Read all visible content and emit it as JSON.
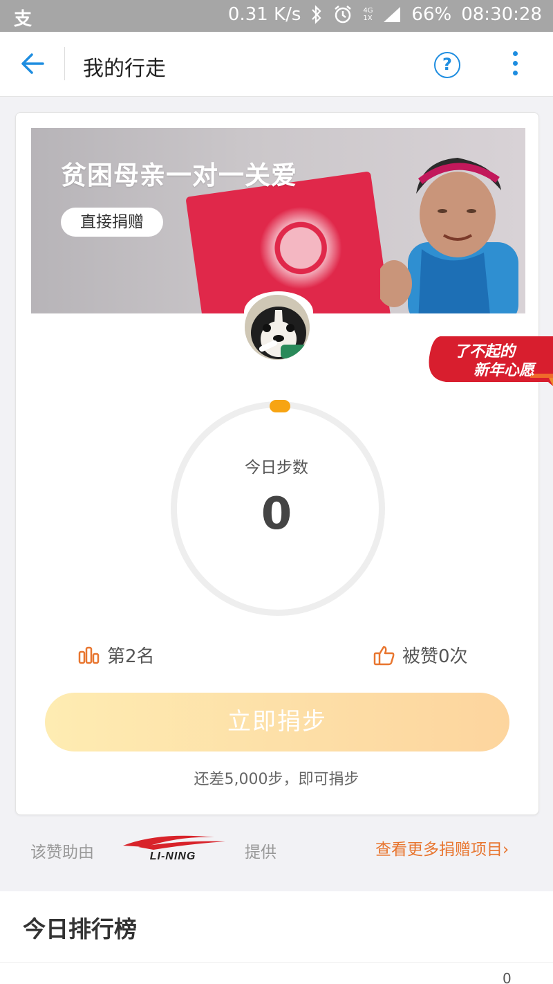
{
  "status_bar": {
    "app_icon": "支",
    "net_speed": "0.31 K/s",
    "network": "4G 1X",
    "battery": "66%",
    "time": "08:30:28",
    "icons": [
      "bluetooth-icon",
      "alarm-icon",
      "signal-icon"
    ]
  },
  "header": {
    "title": "我的行走",
    "help_label": "?",
    "icons": [
      "back-arrow-icon",
      "help-icon",
      "more-icon"
    ]
  },
  "banner": {
    "title": "贫困母亲一对一关爱",
    "button_label": "直接捐赠"
  },
  "ribbon": {
    "line1": "了不起的",
    "line2": "新年心愿"
  },
  "steps": {
    "label": "今日步数",
    "value": "0",
    "ring_progress_fraction": 0.0
  },
  "stats": {
    "rank_label": "第2名",
    "likes_label": "被赞0次"
  },
  "donate": {
    "button_label": "立即捐步",
    "remaining_text": "还差5,000步，即可捐步"
  },
  "sponsor": {
    "prefix": "该赞助由",
    "brand": "LI-NING",
    "suffix": "提供",
    "more_link": "查看更多捐赠项目›"
  },
  "leaderboard": {
    "title": "今日排行榜",
    "first_value": "0"
  },
  "colors": {
    "accent_blue": "#1e8de0",
    "accent_orange": "#e8752e",
    "progress_dot": "#f7a413",
    "ribbon_red": "#d81e2e"
  }
}
